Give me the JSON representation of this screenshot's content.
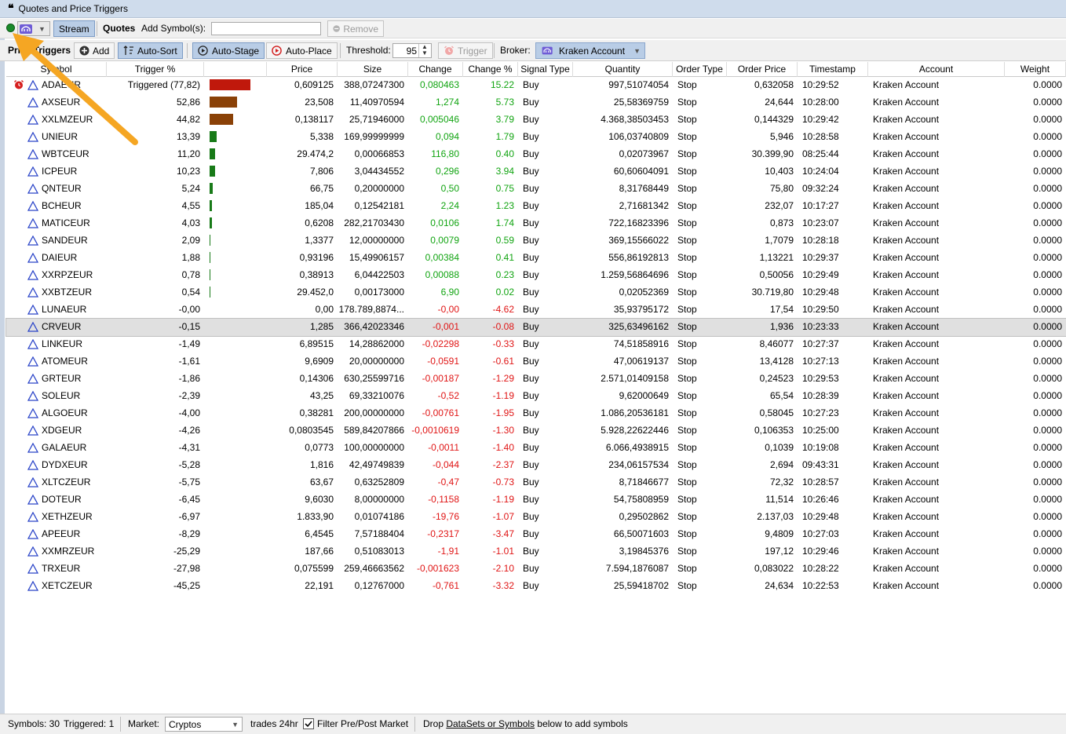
{
  "window": {
    "title": "Quotes and Price Triggers"
  },
  "toolbar1": {
    "stream_label": "Stream",
    "quotes_label": "Quotes",
    "add_symbols_label": "Add Symbol(s):",
    "add_symbols_value": "",
    "remove_label": "Remove"
  },
  "toolbar2": {
    "section_label": "Price Triggers",
    "add_label": "Add",
    "autosort_label": "Auto-Sort",
    "autostage_label": "Auto-Stage",
    "autoplace_label": "Auto-Place",
    "threshold_label": "Threshold:",
    "threshold_value": "95",
    "trigger_label": "Trigger",
    "broker_label": "Broker:",
    "broker_value": "Kraken Account"
  },
  "columns": [
    "Symbol",
    "Trigger %",
    "",
    "Price",
    "Size",
    "Change",
    "Change %",
    "Signal Type",
    "Quantity",
    "Order Type",
    "Order Price",
    "Timestamp",
    "Account",
    "Weight"
  ],
  "rows": [
    {
      "symbol": "ADAEUR",
      "trigger": "Triggered (77,82)",
      "pct": 77.82,
      "price": "0,609125",
      "size": "388,07247300",
      "change": "0,080463",
      "change_pct": "15.22",
      "signal": "Buy",
      "qty": "997,51074054",
      "otype": "Stop",
      "oprice": "0,632058",
      "ts": "10:29:52",
      "account": "Kraken Account",
      "weight": "0.0000",
      "triggered": true,
      "dir": "pos"
    },
    {
      "symbol": "AXSEUR",
      "trigger": "52,86",
      "pct": 52.86,
      "price": "23,508",
      "size": "11,40970594",
      "change": "1,274",
      "change_pct": "5.73",
      "signal": "Buy",
      "qty": "25,58369759",
      "otype": "Stop",
      "oprice": "24,644",
      "ts": "10:28:00",
      "account": "Kraken Account",
      "weight": "0.0000",
      "dir": "pos"
    },
    {
      "symbol": "XXLMZEUR",
      "trigger": "44,82",
      "pct": 44.82,
      "price": "0,138117",
      "size": "25,71946000",
      "change": "0,005046",
      "change_pct": "3.79",
      "signal": "Buy",
      "qty": "4.368,38503453",
      "otype": "Stop",
      "oprice": "0,144329",
      "ts": "10:29:42",
      "account": "Kraken Account",
      "weight": "0.0000",
      "dir": "pos"
    },
    {
      "symbol": "UNIEUR",
      "trigger": "13,39",
      "pct": 13.39,
      "price": "5,338",
      "size": "169,99999999",
      "change": "0,094",
      "change_pct": "1.79",
      "signal": "Buy",
      "qty": "106,03740809",
      "otype": "Stop",
      "oprice": "5,946",
      "ts": "10:28:58",
      "account": "Kraken Account",
      "weight": "0.0000",
      "dir": "pos"
    },
    {
      "symbol": "WBTCEUR",
      "trigger": "11,20",
      "pct": 11.2,
      "price": "29.474,2",
      "size": "0,00066853",
      "change": "116,80",
      "change_pct": "0.40",
      "signal": "Buy",
      "qty": "0,02073967",
      "otype": "Stop",
      "oprice": "30.399,90",
      "ts": "08:25:44",
      "account": "Kraken Account",
      "weight": "0.0000",
      "dir": "pos"
    },
    {
      "symbol": "ICPEUR",
      "trigger": "10,23",
      "pct": 10.23,
      "price": "7,806",
      "size": "3,04434552",
      "change": "0,296",
      "change_pct": "3.94",
      "signal": "Buy",
      "qty": "60,60604091",
      "otype": "Stop",
      "oprice": "10,403",
      "ts": "10:24:04",
      "account": "Kraken Account",
      "weight": "0.0000",
      "dir": "pos"
    },
    {
      "symbol": "QNTEUR",
      "trigger": "5,24",
      "pct": 5.24,
      "price": "66,75",
      "size": "0,20000000",
      "change": "0,50",
      "change_pct": "0.75",
      "signal": "Buy",
      "qty": "8,31768449",
      "otype": "Stop",
      "oprice": "75,80",
      "ts": "09:32:24",
      "account": "Kraken Account",
      "weight": "0.0000",
      "dir": "pos"
    },
    {
      "symbol": "BCHEUR",
      "trigger": "4,55",
      "pct": 4.55,
      "price": "185,04",
      "size": "0,12542181",
      "change": "2,24",
      "change_pct": "1.23",
      "signal": "Buy",
      "qty": "2,71681342",
      "otype": "Stop",
      "oprice": "232,07",
      "ts": "10:17:27",
      "account": "Kraken Account",
      "weight": "0.0000",
      "dir": "pos"
    },
    {
      "symbol": "MATICEUR",
      "trigger": "4,03",
      "pct": 4.03,
      "price": "0,6208",
      "size": "282,21703430",
      "change": "0,0106",
      "change_pct": "1.74",
      "signal": "Buy",
      "qty": "722,16823396",
      "otype": "Stop",
      "oprice": "0,873",
      "ts": "10:23:07",
      "account": "Kraken Account",
      "weight": "0.0000",
      "dir": "pos"
    },
    {
      "symbol": "SANDEUR",
      "trigger": "2,09",
      "pct": 2.09,
      "price": "1,3377",
      "size": "12,00000000",
      "change": "0,0079",
      "change_pct": "0.59",
      "signal": "Buy",
      "qty": "369,15566022",
      "otype": "Stop",
      "oprice": "1,7079",
      "ts": "10:28:18",
      "account": "Kraken Account",
      "weight": "0.0000",
      "dir": "pos"
    },
    {
      "symbol": "DAIEUR",
      "trigger": "1,88",
      "pct": 1.88,
      "price": "0,93196",
      "size": "15,49906157",
      "change": "0,00384",
      "change_pct": "0.41",
      "signal": "Buy",
      "qty": "556,86192813",
      "otype": "Stop",
      "oprice": "1,13221",
      "ts": "10:29:37",
      "account": "Kraken Account",
      "weight": "0.0000",
      "dir": "pos"
    },
    {
      "symbol": "XXRPZEUR",
      "trigger": "0,78",
      "pct": 0.78,
      "price": "0,38913",
      "size": "6,04422503",
      "change": "0,00088",
      "change_pct": "0.23",
      "signal": "Buy",
      "qty": "1.259,56864696",
      "otype": "Stop",
      "oprice": "0,50056",
      "ts": "10:29:49",
      "account": "Kraken Account",
      "weight": "0.0000",
      "dir": "pos"
    },
    {
      "symbol": "XXBTZEUR",
      "trigger": "0,54",
      "pct": 0.54,
      "price": "29.452,0",
      "size": "0,00173000",
      "change": "6,90",
      "change_pct": "0.02",
      "signal": "Buy",
      "qty": "0,02052369",
      "otype": "Stop",
      "oprice": "30.719,80",
      "ts": "10:29:48",
      "account": "Kraken Account",
      "weight": "0.0000",
      "dir": "pos"
    },
    {
      "symbol": "LUNAEUR",
      "trigger": "-0,00",
      "pct": 0,
      "price": "0,00",
      "size": "178.789,8874...",
      "change": "-0,00",
      "change_pct": "-4.62",
      "signal": "Buy",
      "qty": "35,93795172",
      "otype": "Stop",
      "oprice": "17,54",
      "ts": "10:29:50",
      "account": "Kraken Account",
      "weight": "0.0000",
      "dir": "neg"
    },
    {
      "symbol": "CRVEUR",
      "trigger": "-0,15",
      "pct": 0,
      "price": "1,285",
      "size": "366,42023346",
      "change": "-0,001",
      "change_pct": "-0.08",
      "signal": "Buy",
      "qty": "325,63496162",
      "otype": "Stop",
      "oprice": "1,936",
      "ts": "10:23:33",
      "account": "Kraken Account",
      "weight": "0.0000",
      "selected": true,
      "dir": "neg"
    },
    {
      "symbol": "LINKEUR",
      "trigger": "-1,49",
      "pct": 0,
      "price": "6,89515",
      "size": "14,28862000",
      "change": "-0,02298",
      "change_pct": "-0.33",
      "signal": "Buy",
      "qty": "74,51858916",
      "otype": "Stop",
      "oprice": "8,46077",
      "ts": "10:27:37",
      "account": "Kraken Account",
      "weight": "0.0000",
      "dir": "neg"
    },
    {
      "symbol": "ATOMEUR",
      "trigger": "-1,61",
      "pct": 0,
      "price": "9,6909",
      "size": "20,00000000",
      "change": "-0,0591",
      "change_pct": "-0.61",
      "signal": "Buy",
      "qty": "47,00619137",
      "otype": "Stop",
      "oprice": "13,4128",
      "ts": "10:27:13",
      "account": "Kraken Account",
      "weight": "0.0000",
      "dir": "neg"
    },
    {
      "symbol": "GRTEUR",
      "trigger": "-1,86",
      "pct": 0,
      "price": "0,14306",
      "size": "630,25599716",
      "change": "-0,00187",
      "change_pct": "-1.29",
      "signal": "Buy",
      "qty": "2.571,01409158",
      "otype": "Stop",
      "oprice": "0,24523",
      "ts": "10:29:53",
      "account": "Kraken Account",
      "weight": "0.0000",
      "dir": "neg"
    },
    {
      "symbol": "SOLEUR",
      "trigger": "-2,39",
      "pct": 0,
      "price": "43,25",
      "size": "69,33210076",
      "change": "-0,52",
      "change_pct": "-1.19",
      "signal": "Buy",
      "qty": "9,62000649",
      "otype": "Stop",
      "oprice": "65,54",
      "ts": "10:28:39",
      "account": "Kraken Account",
      "weight": "0.0000",
      "dir": "neg"
    },
    {
      "symbol": "ALGOEUR",
      "trigger": "-4,00",
      "pct": 0,
      "price": "0,38281",
      "size": "200,00000000",
      "change": "-0,00761",
      "change_pct": "-1.95",
      "signal": "Buy",
      "qty": "1.086,20536181",
      "otype": "Stop",
      "oprice": "0,58045",
      "ts": "10:27:23",
      "account": "Kraken Account",
      "weight": "0.0000",
      "dir": "neg"
    },
    {
      "symbol": "XDGEUR",
      "trigger": "-4,26",
      "pct": 0,
      "price": "0,0803545",
      "size": "589,84207866",
      "change": "-0,0010619",
      "change_pct": "-1.30",
      "signal": "Buy",
      "qty": "5.928,22622446",
      "otype": "Stop",
      "oprice": "0,106353",
      "ts": "10:25:00",
      "account": "Kraken Account",
      "weight": "0.0000",
      "dir": "neg"
    },
    {
      "symbol": "GALAEUR",
      "trigger": "-4,31",
      "pct": 0,
      "price": "0,0773",
      "size": "100,00000000",
      "change": "-0,0011",
      "change_pct": "-1.40",
      "signal": "Buy",
      "qty": "6.066,4938915",
      "otype": "Stop",
      "oprice": "0,1039",
      "ts": "10:19:08",
      "account": "Kraken Account",
      "weight": "0.0000",
      "dir": "neg"
    },
    {
      "symbol": "DYDXEUR",
      "trigger": "-5,28",
      "pct": 0,
      "price": "1,816",
      "size": "42,49749839",
      "change": "-0,044",
      "change_pct": "-2.37",
      "signal": "Buy",
      "qty": "234,06157534",
      "otype": "Stop",
      "oprice": "2,694",
      "ts": "09:43:31",
      "account": "Kraken Account",
      "weight": "0.0000",
      "dir": "neg"
    },
    {
      "symbol": "XLTCZEUR",
      "trigger": "-5,75",
      "pct": 0,
      "price": "63,67",
      "size": "0,63252809",
      "change": "-0,47",
      "change_pct": "-0.73",
      "signal": "Buy",
      "qty": "8,71846677",
      "otype": "Stop",
      "oprice": "72,32",
      "ts": "10:28:57",
      "account": "Kraken Account",
      "weight": "0.0000",
      "dir": "neg"
    },
    {
      "symbol": "DOTEUR",
      "trigger": "-6,45",
      "pct": 0,
      "price": "9,6030",
      "size": "8,00000000",
      "change": "-0,1158",
      "change_pct": "-1.19",
      "signal": "Buy",
      "qty": "54,75808959",
      "otype": "Stop",
      "oprice": "11,514",
      "ts": "10:26:46",
      "account": "Kraken Account",
      "weight": "0.0000",
      "dir": "neg"
    },
    {
      "symbol": "XETHZEUR",
      "trigger": "-6,97",
      "pct": 0,
      "price": "1.833,90",
      "size": "0,01074186",
      "change": "-19,76",
      "change_pct": "-1.07",
      "signal": "Buy",
      "qty": "0,29502862",
      "otype": "Stop",
      "oprice": "2.137,03",
      "ts": "10:29:48",
      "account": "Kraken Account",
      "weight": "0.0000",
      "dir": "neg"
    },
    {
      "symbol": "APEEUR",
      "trigger": "-8,29",
      "pct": 0,
      "price": "6,4545",
      "size": "7,57188404",
      "change": "-0,2317",
      "change_pct": "-3.47",
      "signal": "Buy",
      "qty": "66,50071603",
      "otype": "Stop",
      "oprice": "9,4809",
      "ts": "10:27:03",
      "account": "Kraken Account",
      "weight": "0.0000",
      "dir": "neg"
    },
    {
      "symbol": "XXMRZEUR",
      "trigger": "-25,29",
      "pct": 0,
      "price": "187,66",
      "size": "0,51083013",
      "change": "-1,91",
      "change_pct": "-1.01",
      "signal": "Buy",
      "qty": "3,19845376",
      "otype": "Stop",
      "oprice": "197,12",
      "ts": "10:29:46",
      "account": "Kraken Account",
      "weight": "0.0000",
      "dir": "neg"
    },
    {
      "symbol": "TRXEUR",
      "trigger": "-27,98",
      "pct": 0,
      "price": "0,075599",
      "size": "259,46663562",
      "change": "-0,001623",
      "change_pct": "-2.10",
      "signal": "Buy",
      "qty": "7.594,1876087",
      "otype": "Stop",
      "oprice": "0,083022",
      "ts": "10:28:22",
      "account": "Kraken Account",
      "weight": "0.0000",
      "dir": "neg"
    },
    {
      "symbol": "XETCZEUR",
      "trigger": "-45,25",
      "pct": 0,
      "price": "22,191",
      "size": "0,12767000",
      "change": "-0,761",
      "change_pct": "-3.32",
      "signal": "Buy",
      "qty": "25,59418702",
      "otype": "Stop",
      "oprice": "24,634",
      "ts": "10:22:53",
      "account": "Kraken Account",
      "weight": "0.0000",
      "dir": "neg"
    }
  ],
  "statusbar": {
    "symbols_label": "Symbols: 30",
    "triggered_label": "Triggered: 1",
    "market_label": "Market:",
    "market_value": "Cryptos",
    "trades_label": "trades 24hr",
    "filter_label": "Filter Pre/Post Market",
    "filter_checked": true,
    "drop_prefix": "Drop ",
    "drop_link": "DataSets or Symbols",
    "drop_suffix": " below to add symbols"
  },
  "colors": {
    "positive": "#11a411",
    "negative": "#e01515",
    "bar_red": "#c0180c",
    "bar_brown": "#8a4107",
    "bar_green": "#187a18",
    "arrow": "#f5a623"
  }
}
